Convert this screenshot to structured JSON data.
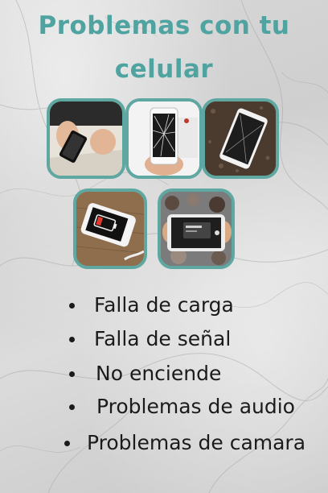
{
  "title": {
    "line1": "Problemas con tu",
    "line2": "celular"
  },
  "photos": [
    {
      "name": "phone-in-hands-photo"
    },
    {
      "name": "cracked-screen-photo"
    },
    {
      "name": "broken-phone-on-ground-photo"
    },
    {
      "name": "low-battery-photo"
    },
    {
      "name": "camera-app-photo"
    }
  ],
  "problems": [
    "Falla de carga",
    "Falla de señal",
    "No enciende",
    "Problemas de audio",
    "Problemas de camara"
  ],
  "colors": {
    "accent": "#4fa3a0",
    "frame": "#5fa8a2",
    "text": "#1b1b1b"
  }
}
